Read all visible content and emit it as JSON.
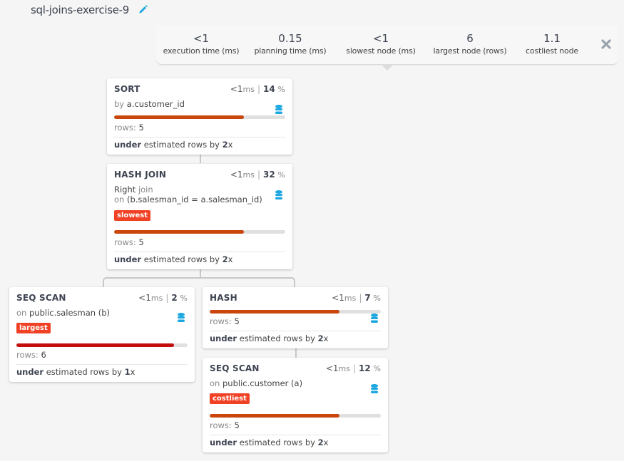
{
  "header": {
    "title": "sql-joins-exercise-9",
    "edit_icon": "pencil-icon"
  },
  "stats": [
    {
      "value": "<1",
      "label": "execution time (ms)"
    },
    {
      "value": "0.15",
      "label": "planning time (ms)"
    },
    {
      "value": "<1",
      "label": "slowest node (ms)"
    },
    {
      "value": "6",
      "label": "largest node (rows)"
    },
    {
      "value": "1.1",
      "label": "costliest node"
    }
  ],
  "close_icon": "close-icon",
  "colors": {
    "accent_blue": "#1ca7e0",
    "bar_orange": "#c9470c",
    "bar_red": "#c40f0f",
    "badge_red": "#f04124"
  },
  "nodes": {
    "sort": {
      "name": "SORT",
      "time": "<1",
      "time_unit": "ms",
      "pct": "14",
      "pct_unit": "%",
      "desc_muted": "by",
      "desc_value": "a.customer_id",
      "bar_fraction": 0.76,
      "rows_label": "rows:",
      "rows": "5",
      "est_prefix": "under",
      "est_mid": "estimated rows by",
      "est_factor": "2",
      "est_suffix": "x"
    },
    "hash_join": {
      "name": "HASH JOIN",
      "time": "<1",
      "time_unit": "ms",
      "pct": "32",
      "pct_unit": "%",
      "line1_value": "Right",
      "line1_muted": "join",
      "line2_muted": "on",
      "line2_value": "(b.salesman_id = a.salesman_id)",
      "badge": "slowest",
      "bar_fraction": 0.76,
      "rows_label": "rows:",
      "rows": "5",
      "est_prefix": "under",
      "est_mid": "estimated rows by",
      "est_factor": "2",
      "est_suffix": "x"
    },
    "seq_scan_salesman": {
      "name": "SEQ SCAN",
      "time": "<1",
      "time_unit": "ms",
      "pct": "2",
      "pct_unit": "%",
      "desc_muted": "on",
      "desc_value": "public.salesman (b)",
      "badge": "largest",
      "bar_fraction": 0.92,
      "rows_label": "rows:",
      "rows": "6",
      "est_prefix": "under",
      "est_mid": "estimated rows by",
      "est_factor": "1",
      "est_suffix": "x"
    },
    "hash": {
      "name": "HASH",
      "time": "<1",
      "time_unit": "ms",
      "pct": "7",
      "pct_unit": "%",
      "bar_fraction": 0.76,
      "rows_label": "rows:",
      "rows": "5",
      "est_prefix": "under",
      "est_mid": "estimated rows by",
      "est_factor": "2",
      "est_suffix": "x"
    },
    "seq_scan_customer": {
      "name": "SEQ SCAN",
      "time": "<1",
      "time_unit": "ms",
      "pct": "12",
      "pct_unit": "%",
      "desc_muted": "on",
      "desc_value": "public.customer (a)",
      "badge": "costliest",
      "bar_fraction": 0.76,
      "rows_label": "rows:",
      "rows": "5",
      "est_prefix": "under",
      "est_mid": "estimated rows by",
      "est_factor": "2",
      "est_suffix": "x"
    }
  }
}
